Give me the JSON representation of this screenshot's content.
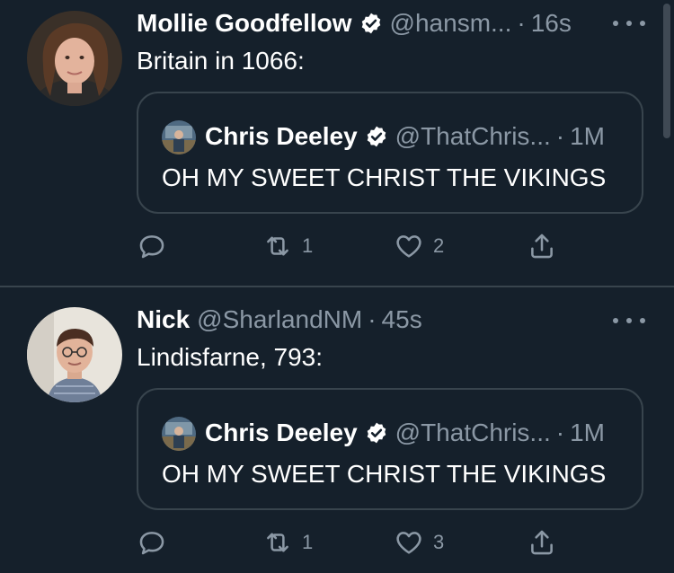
{
  "tweets": [
    {
      "author_name": "Mollie Goodfellow",
      "handle": "@hansm...",
      "separator": "·",
      "time": "16s",
      "text": "Britain in 1066:",
      "quoted": {
        "author_name": "Chris Deeley",
        "handle": "@ThatChris...",
        "separator": "·",
        "time": "1M",
        "text": "OH MY SWEET CHRIST THE VIKINGS"
      },
      "retweet_count": "1",
      "like_count": "2"
    },
    {
      "author_name": "Nick",
      "handle": "@SharlandNM",
      "separator": "·",
      "time": "45s",
      "text": "Lindisfarne, 793:",
      "quoted": {
        "author_name": "Chris Deeley",
        "handle": "@ThatChris...",
        "separator": "·",
        "time": "1M",
        "text": "OH MY SWEET CHRIST THE VIKINGS"
      },
      "retweet_count": "1",
      "like_count": "3"
    }
  ],
  "icons": {
    "verified": "verified-badge-icon",
    "more": "more-options-icon",
    "reply": "reply-icon",
    "retweet": "retweet-icon",
    "like": "heart-icon",
    "share": "share-icon"
  },
  "colors": {
    "background": "#15202b",
    "border": "#38444d",
    "secondary_text": "#8b98a5",
    "primary_text": "#ffffff"
  }
}
